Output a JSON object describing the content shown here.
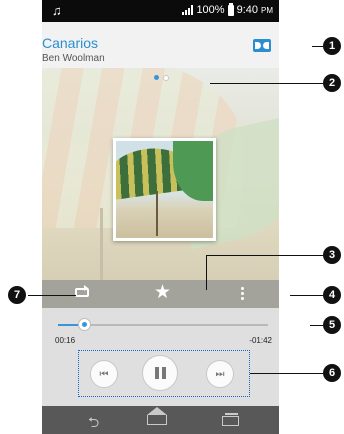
{
  "status_bar": {
    "percent": "100%",
    "time": "9:40",
    "ampm": "PM"
  },
  "track": {
    "title": "Canarios",
    "artist": "Ben Woolman"
  },
  "pager": {
    "pages": 2,
    "current": 1
  },
  "progress": {
    "elapsed": "00:16",
    "remaining": "-01:42",
    "fraction": 0.13
  },
  "icons": {
    "status": [
      "music-note-icon",
      "signal-icon",
      "battery-icon"
    ],
    "title_bar": [
      "dolby-icon"
    ],
    "controls": [
      "repeat-icon",
      "favorite-star-icon",
      "more-menu-icon"
    ],
    "transport": [
      "previous-icon",
      "pause-icon",
      "next-icon"
    ],
    "nav": [
      "back-icon",
      "home-icon",
      "recent-apps-icon"
    ]
  },
  "callouts": [
    "1",
    "2",
    "3",
    "4",
    "5",
    "6",
    "7"
  ],
  "colors": {
    "accent": "#2a8fd0",
    "progress_fill": "#3a95d8",
    "callout": "#111111"
  }
}
